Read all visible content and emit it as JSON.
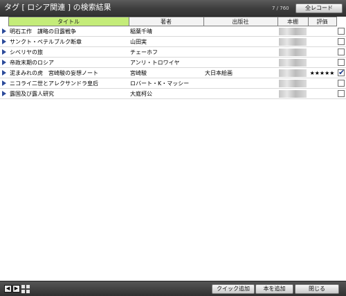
{
  "header": {
    "title": "タグ [ ロシア関連 ] の検索結果",
    "count": "7 / 760",
    "all_records_label": "全レコード"
  },
  "table": {
    "columns": [
      "タイトル",
      "著者",
      "出版社",
      "本棚",
      "評価"
    ],
    "rows": [
      {
        "title": "明石工作　謀略の日露戦争",
        "author": "稲葉千晴",
        "publisher": "",
        "rating": "",
        "checked": false
      },
      {
        "title": "サンクト・ペテルブルク断章",
        "author": "山田実",
        "publisher": "",
        "rating": "",
        "checked": false
      },
      {
        "title": "シベリヤの旅",
        "author": "チェーホフ",
        "publisher": "",
        "rating": "",
        "checked": false
      },
      {
        "title": "帝政末期のロシア",
        "author": "アンリ・トロワイヤ",
        "publisher": "",
        "rating": "",
        "checked": false
      },
      {
        "title": "泥まみれの虎　宮崎駿の妄想ノート",
        "author": "宮崎駿",
        "publisher": "大日本絵画",
        "rating": "★★★★★",
        "checked": true
      },
      {
        "title": "ニコライ二世とアレクサンドラ皇后",
        "author": "ロバート・K・マッシー",
        "publisher": "",
        "rating": "",
        "checked": false
      },
      {
        "title": "露国及び露人研究",
        "author": "大庭柯公",
        "publisher": "",
        "rating": "",
        "checked": false
      }
    ]
  },
  "footer": {
    "prev_icon": "◀",
    "next_icon": "▶",
    "quick_add_label": "クイック追加",
    "add_book_label": "本を追加",
    "close_label": "閉じる"
  },
  "colors": {
    "sorted_header": "#c4ec79",
    "row_arrow": "#2b4a9a",
    "header_bg": "#3d3d3d"
  }
}
